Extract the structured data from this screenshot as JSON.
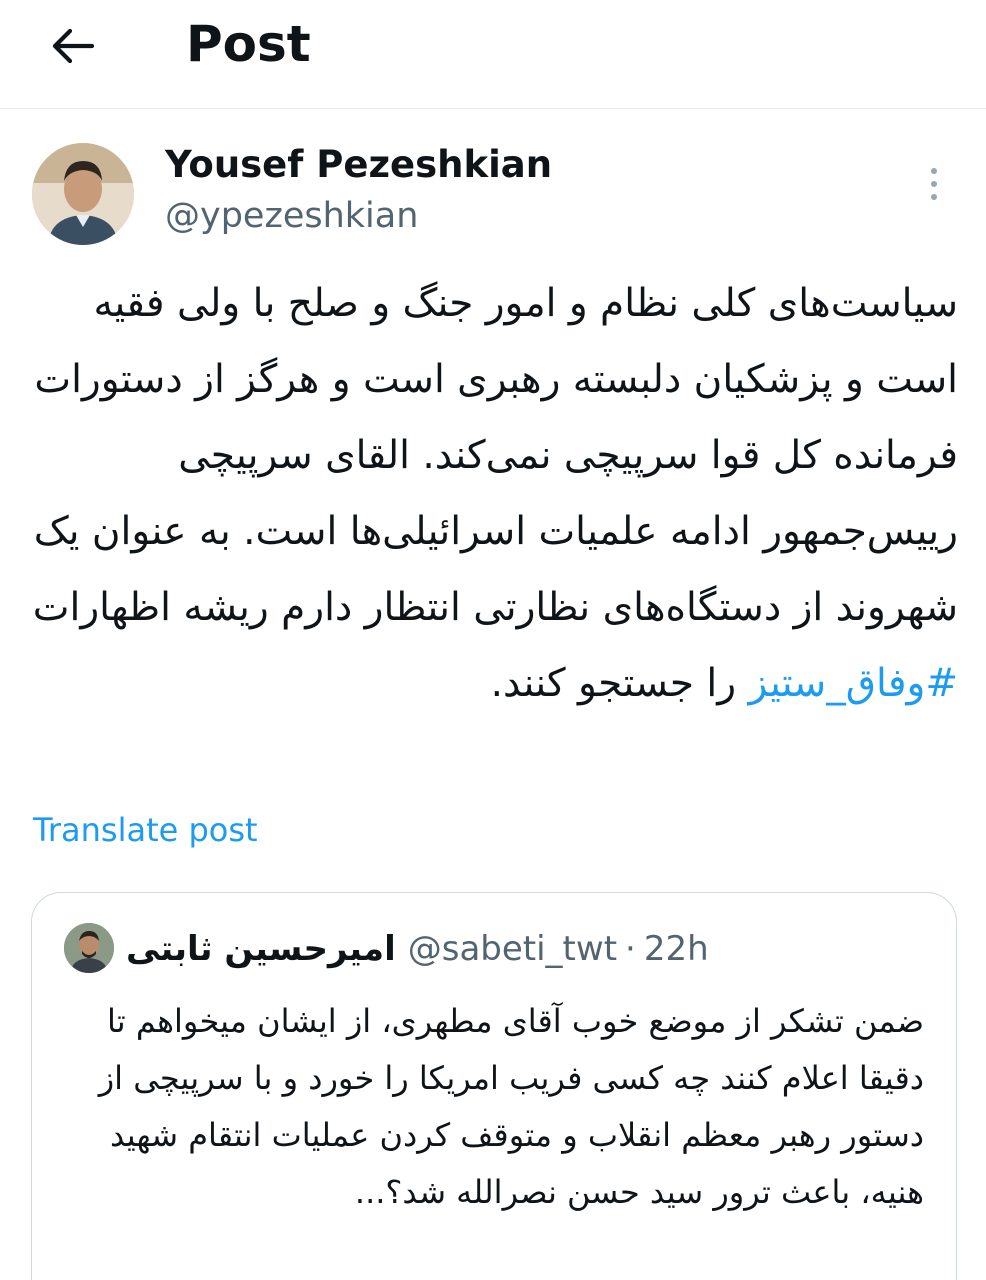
{
  "header": {
    "title": "Post",
    "back_icon": "arrow-left-icon"
  },
  "author": {
    "name": "Yousef Pezeshkian",
    "handle": "@ypezeshkian",
    "avatar_icon": "user-avatar"
  },
  "more_icon": "vertical-ellipsis-icon",
  "tweet": {
    "text_before": "سیاست‌های کلی نظام و امور جنگ و صلح با ولی فقیه است و پزشکیان دلبسته رهبری است و هرگز از دستورات فرمانده کل قوا سرپیچی نمی‌کند. القای سرپیچی رییس‌جمهور ادامه علمیات اسرائیلی‌ها است. به عنوان یک شهروند از دستگاه‌های نظارتی انتظار دارم ریشه اظهارات ",
    "hashtag": "#وفاق_ستیز",
    "text_after": " را جستجو کنند."
  },
  "translate_label": "Translate post",
  "quote": {
    "name": "امیرحسین ثابتی",
    "handle": "@sabeti_twt",
    "separator": "·",
    "time": "22h",
    "text": "ضمن تشکر از موضع خوب آقای مطهری، از ایشان میخواهم تا دقیقا اعلام کنند چه کسی فریب امریکا را خورد و با سرپیچی از دستور رهبر معظم انقلاب و متوقف کردن عملیات انتقام شهید هنیه، باعث ترور سید حسن نصرالله شد؟..."
  },
  "colors": {
    "accent": "#1d9bf0",
    "text": "#0f1419",
    "secondary": "#536471",
    "border": "#cfd9de"
  }
}
